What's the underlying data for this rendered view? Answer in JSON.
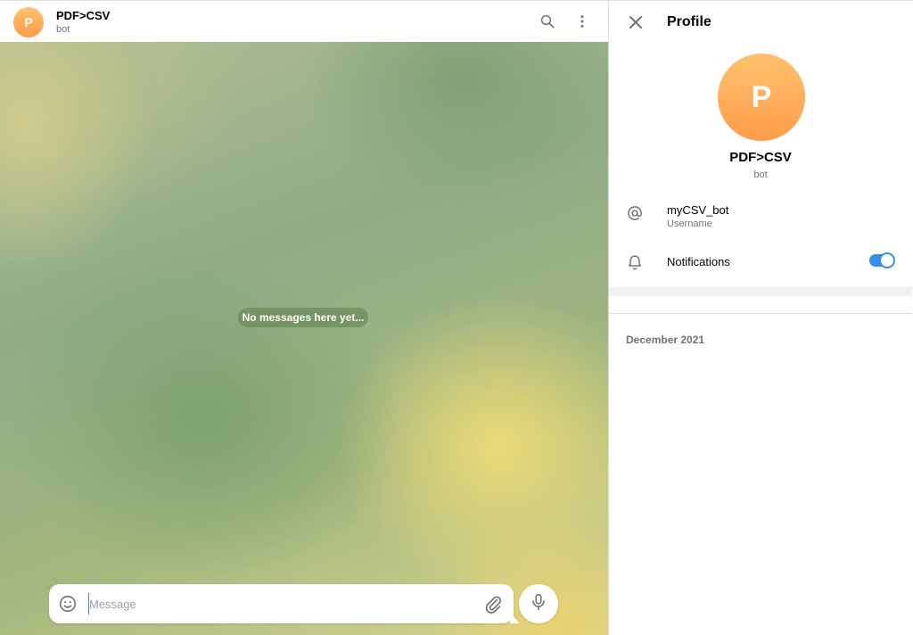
{
  "chat": {
    "title": "PDF>CSV",
    "subtitle": "bot",
    "avatar_letter": "P",
    "empty_state": "No messages here yet...",
    "composer": {
      "placeholder": "Message"
    },
    "header_icons": [
      "search-icon",
      "more-vertical-icon"
    ]
  },
  "profile": {
    "heading": "Profile",
    "avatar_letter": "P",
    "name": "PDF>CSV",
    "subtitle": "bot",
    "username": {
      "value": "myCSV_bot",
      "label": "Username"
    },
    "notifications": {
      "label": "Notifications",
      "enabled": true
    },
    "section_date": "December 2021"
  },
  "colors": {
    "accent": "#3390ec",
    "avatar_top": "#ffc16e",
    "avatar_bottom": "#ff9d4a",
    "secondary_text": "#707579"
  }
}
